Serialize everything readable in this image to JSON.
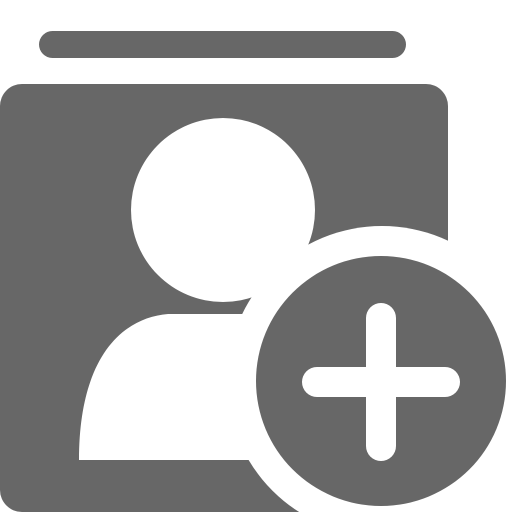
{
  "icon": {
    "name": "add-contact-icon",
    "parts": [
      "contact-card-stack-icon",
      "person-silhouette-icon",
      "plus-badge-icon"
    ],
    "colors": {
      "glyph": "#676767",
      "background": "#ffffff"
    }
  }
}
